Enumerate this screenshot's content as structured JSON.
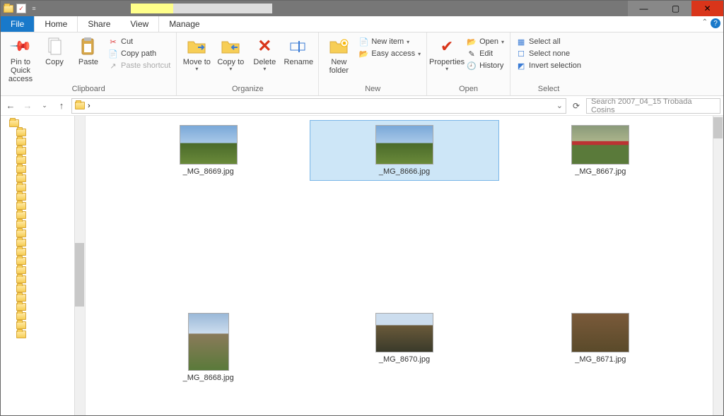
{
  "window": {
    "min": "—",
    "max": "▢",
    "close": "✕"
  },
  "tabs": {
    "file": "File",
    "home": "Home",
    "share": "Share",
    "view": "View",
    "manage": "Manage"
  },
  "ribbon": {
    "clipboard": {
      "label": "Clipboard",
      "pin": "Pin to Quick access",
      "copy": "Copy",
      "paste": "Paste",
      "cut": "Cut",
      "copy_path": "Copy path",
      "paste_shortcut": "Paste shortcut"
    },
    "organize": {
      "label": "Organize",
      "move_to": "Move to",
      "copy_to": "Copy to",
      "delete": "Delete",
      "rename": "Rename"
    },
    "new": {
      "label": "New",
      "new_folder": "New folder",
      "new_item": "New item",
      "easy_access": "Easy access"
    },
    "open": {
      "label": "Open",
      "properties": "Properties",
      "open": "Open",
      "edit": "Edit",
      "history": "History"
    },
    "select": {
      "label": "Select",
      "select_all": "Select all",
      "select_none": "Select none",
      "invert": "Invert selection"
    }
  },
  "nav": {
    "breadcrumb_sep": "›",
    "dropdown_hint": "⌄",
    "search_placeholder": "Search 2007_04_15  Trobada Cosins"
  },
  "files": {
    "f1": "_MG_8669.jpg",
    "f2": "_MG_8666.jpg",
    "f3": "_MG_8667.jpg",
    "f4": "_MG_8668.jpg",
    "f5": "_MG_8670.jpg",
    "f6": "_MG_8671.jpg"
  }
}
